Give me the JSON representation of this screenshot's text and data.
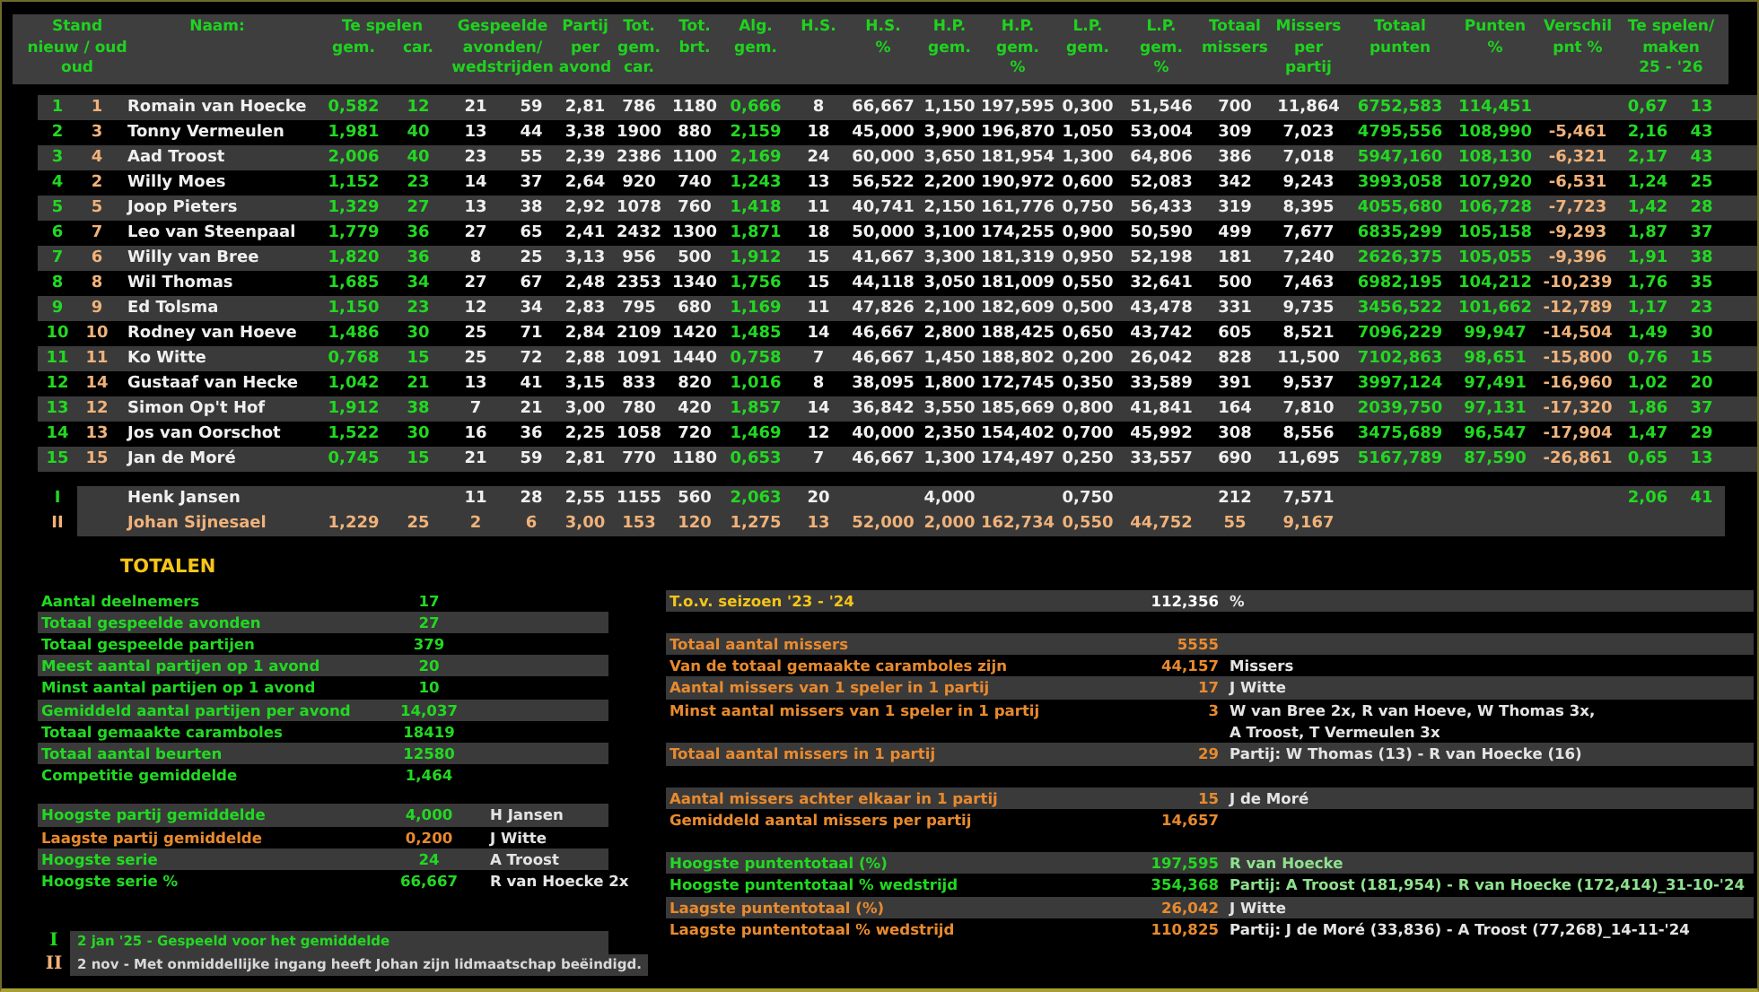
{
  "table": {
    "header": [
      {
        "lines": [
          "Stand",
          "nieuw / oud",
          "oud"
        ],
        "kind": "double"
      },
      {
        "lines": [
          "Naam:"
        ]
      },
      {
        "lines": [
          "Te spelen"
        ],
        "sub": [
          "gem.",
          "car."
        ]
      },
      {
        "lines": [
          "Gespeelde",
          "avonden/",
          "wedstrijden"
        ],
        "kind": "double"
      },
      {
        "lines": [
          "Partij",
          "per",
          "avond"
        ]
      },
      {
        "lines": [
          "Tot.",
          "gem.",
          "car."
        ]
      },
      {
        "lines": [
          "Tot.",
          "brt."
        ]
      },
      {
        "lines": [
          "Alg.",
          "gem."
        ]
      },
      {
        "lines": [
          "H.S."
        ]
      },
      {
        "lines": [
          "H.S.",
          "%"
        ]
      },
      {
        "lines": [
          "H.P.",
          "gem."
        ]
      },
      {
        "lines": [
          "H.P.",
          "gem.",
          "%"
        ]
      },
      {
        "lines": [
          "L.P.",
          "gem."
        ]
      },
      {
        "lines": [
          "L.P.",
          "gem.",
          "%"
        ]
      },
      {
        "lines": [
          "Totaal",
          "missers"
        ]
      },
      {
        "lines": [
          "Missers",
          "per",
          "partij"
        ]
      },
      {
        "lines": [
          "Totaal",
          "punten"
        ]
      },
      {
        "lines": [
          "Punten",
          "%"
        ]
      },
      {
        "lines": [
          "Verschil",
          "pnt %"
        ]
      },
      {
        "lines": [
          "Te spelen/",
          "maken",
          "25 - '26"
        ],
        "kind": "double"
      }
    ],
    "rows": [
      {
        "kind": "regular",
        "cells": [
          "1",
          "1",
          "Romain van Hoecke",
          "0,582",
          "12",
          "21",
          "59",
          "2,81",
          "786",
          "1180",
          "0,666",
          "8",
          "66,667",
          "1,150",
          "197,595",
          "0,300",
          "51,546",
          "700",
          "11,864",
          "6752,583",
          "114,451",
          null,
          "0,67",
          "13"
        ]
      },
      {
        "kind": "regular",
        "cells": [
          "2",
          "3",
          "Tonny Vermeulen",
          "1,981",
          "40",
          "13",
          "44",
          "3,38",
          "1900",
          "880",
          "2,159",
          "18",
          "45,000",
          "3,900",
          "196,870",
          "1,050",
          "53,004",
          "309",
          "7,023",
          "4795,556",
          "108,990",
          "-5,461",
          "2,16",
          "43"
        ]
      },
      {
        "kind": "regular",
        "cells": [
          "3",
          "4",
          "Aad Troost",
          "2,006",
          "40",
          "23",
          "55",
          "2,39",
          "2386",
          "1100",
          "2,169",
          "24",
          "60,000",
          "3,650",
          "181,954",
          "1,300",
          "64,806",
          "386",
          "7,018",
          "5947,160",
          "108,130",
          "-6,321",
          "2,17",
          "43"
        ]
      },
      {
        "kind": "regular",
        "cells": [
          "4",
          "2",
          "Willy Moes",
          "1,152",
          "23",
          "14",
          "37",
          "2,64",
          "920",
          "740",
          "1,243",
          "13",
          "56,522",
          "2,200",
          "190,972",
          "0,600",
          "52,083",
          "342",
          "9,243",
          "3993,058",
          "107,920",
          "-6,531",
          "1,24",
          "25"
        ]
      },
      {
        "kind": "regular",
        "cells": [
          "5",
          "5",
          "Joop Pieters",
          "1,329",
          "27",
          "13",
          "38",
          "2,92",
          "1078",
          "760",
          "1,418",
          "11",
          "40,741",
          "2,150",
          "161,776",
          "0,750",
          "56,433",
          "319",
          "8,395",
          "4055,680",
          "106,728",
          "-7,723",
          "1,42",
          "28"
        ]
      },
      {
        "kind": "regular",
        "cells": [
          "6",
          "7",
          "Leo van Steenpaal",
          "1,779",
          "36",
          "27",
          "65",
          "2,41",
          "2432",
          "1300",
          "1,871",
          "18",
          "50,000",
          "3,100",
          "174,255",
          "0,900",
          "50,590",
          "499",
          "7,677",
          "6835,299",
          "105,158",
          "-9,293",
          "1,87",
          "37"
        ]
      },
      {
        "kind": "regular",
        "cells": [
          "7",
          "6",
          "Willy van Bree",
          "1,820",
          "36",
          "8",
          "25",
          "3,13",
          "956",
          "500",
          "1,912",
          "15",
          "41,667",
          "3,300",
          "181,319",
          "0,950",
          "52,198",
          "181",
          "7,240",
          "2626,375",
          "105,055",
          "-9,396",
          "1,91",
          "38"
        ]
      },
      {
        "kind": "regular",
        "cells": [
          "8",
          "8",
          "Wil Thomas",
          "1,685",
          "34",
          "27",
          "67",
          "2,48",
          "2353",
          "1340",
          "1,756",
          "15",
          "44,118",
          "3,050",
          "181,009",
          "0,550",
          "32,641",
          "500",
          "7,463",
          "6982,195",
          "104,212",
          "-10,239",
          "1,76",
          "35"
        ]
      },
      {
        "kind": "regular",
        "cells": [
          "9",
          "9",
          "Ed Tolsma",
          "1,150",
          "23",
          "12",
          "34",
          "2,83",
          "795",
          "680",
          "1,169",
          "11",
          "47,826",
          "2,100",
          "182,609",
          "0,500",
          "43,478",
          "331",
          "9,735",
          "3456,522",
          "101,662",
          "-12,789",
          "1,17",
          "23"
        ]
      },
      {
        "kind": "regular",
        "cells": [
          "10",
          "10",
          "Rodney van Hoeve",
          "1,486",
          "30",
          "25",
          "71",
          "2,84",
          "2109",
          "1420",
          "1,485",
          "14",
          "46,667",
          "2,800",
          "188,425",
          "0,650",
          "43,742",
          "605",
          "8,521",
          "7096,229",
          "99,947",
          "-14,504",
          "1,49",
          "30"
        ]
      },
      {
        "kind": "regular",
        "cells": [
          "11",
          "11",
          "Ko Witte",
          "0,768",
          "15",
          "25",
          "72",
          "2,88",
          "1091",
          "1440",
          "0,758",
          "7",
          "46,667",
          "1,450",
          "188,802",
          "0,200",
          "26,042",
          "828",
          "11,500",
          "7102,863",
          "98,651",
          "-15,800",
          "0,76",
          "15"
        ]
      },
      {
        "kind": "regular",
        "cells": [
          "12",
          "14",
          "Gustaaf van Hecke",
          "1,042",
          "21",
          "13",
          "41",
          "3,15",
          "833",
          "820",
          "1,016",
          "8",
          "38,095",
          "1,800",
          "172,745",
          "0,350",
          "33,589",
          "391",
          "9,537",
          "3997,124",
          "97,491",
          "-16,960",
          "1,02",
          "20"
        ]
      },
      {
        "kind": "regular",
        "cells": [
          "13",
          "12",
          "Simon Op't Hof",
          "1,912",
          "38",
          "7",
          "21",
          "3,00",
          "780",
          "420",
          "1,857",
          "14",
          "36,842",
          "3,550",
          "185,669",
          "0,800",
          "41,841",
          "164",
          "7,810",
          "2039,750",
          "97,131",
          "-17,320",
          "1,86",
          "37"
        ]
      },
      {
        "kind": "regular",
        "cells": [
          "14",
          "13",
          "Jos van Oorschot",
          "1,522",
          "30",
          "16",
          "36",
          "2,25",
          "1058",
          "720",
          "1,469",
          "12",
          "40,000",
          "2,350",
          "154,402",
          "0,700",
          "45,992",
          "308",
          "8,556",
          "3475,689",
          "96,547",
          "-17,904",
          "1,47",
          "29"
        ]
      },
      {
        "kind": "regular",
        "cells": [
          "15",
          "15",
          "Jan de Moré",
          "0,745",
          "15",
          "21",
          "59",
          "2,81",
          "770",
          "1180",
          "0,653",
          "7",
          "46,667",
          "1,300",
          "174,497",
          "0,250",
          "33,557",
          "690",
          "11,695",
          "5167,789",
          "87,590",
          "-26,861",
          "0,65",
          "13"
        ]
      },
      {
        "kind": "guest",
        "cells": [
          "I",
          null,
          "Henk Jansen",
          null,
          null,
          "11",
          "28",
          "2,55",
          "1155",
          "560",
          "2,063",
          "20",
          null,
          "4,000",
          null,
          "0,750",
          null,
          "212",
          "7,571",
          null,
          null,
          null,
          "2,06",
          "41"
        ]
      },
      {
        "kind": "retired",
        "cells": [
          "II",
          null,
          "Johan Sijnesael",
          "1,229",
          "25",
          "2",
          "6",
          "3,00",
          "153",
          "120",
          "1,275",
          "13",
          "52,000",
          "2,000",
          "162,734",
          "0,550",
          "44,752",
          "55",
          "9,167",
          null,
          null,
          null,
          null,
          null
        ]
      }
    ]
  },
  "totals": {
    "title": "TOTALEN",
    "groups": [
      [
        {
          "kind": "positive",
          "shaded": false,
          "label": "Aantal deelnemers",
          "value": "17"
        },
        {
          "kind": "positive",
          "shaded": true,
          "label": "Totaal gespeelde avonden",
          "value": "27"
        },
        {
          "kind": "positive",
          "shaded": false,
          "label": "Totaal gespeelde partijen",
          "value": "379"
        },
        {
          "kind": "positive",
          "shaded": true,
          "label": "Meest aantal partijen op 1 avond",
          "value": "20"
        },
        {
          "kind": "positive",
          "shaded": false,
          "label": "Minst aantal partijen op 1 avond",
          "value": "10"
        },
        {
          "kind": "positive",
          "shaded": true,
          "label": "Gemiddeld aantal partijen per avond",
          "value": "14,037"
        },
        {
          "kind": "positive",
          "shaded": false,
          "label": "Totaal gemaakte caramboles",
          "value": "18419"
        },
        {
          "kind": "positive",
          "shaded": true,
          "label": "Totaal aantal beurten",
          "value": "12580"
        },
        {
          "kind": "positive",
          "shaded": false,
          "label": "Competitie gemiddelde",
          "value": "1,464"
        }
      ],
      [
        {
          "kind": "positive",
          "shaded": true,
          "label": "Hoogste partij gemiddelde",
          "value": "4,000",
          "note": "H Jansen"
        },
        {
          "kind": "negative",
          "shaded": false,
          "label": "Laagste partij gemiddelde",
          "value": "0,200",
          "note": "J Witte"
        },
        {
          "kind": "positive",
          "shaded": true,
          "label": "Hoogste serie",
          "value": "24",
          "note": "A Troost"
        },
        {
          "kind": "positive",
          "shaded": false,
          "label": "Hoogste serie %",
          "value": "66,667",
          "note": "R van Hoecke 2x"
        }
      ]
    ]
  },
  "footnotes": [
    {
      "kind": "guest",
      "marker": "I",
      "text": "2 jan '25 - Gespeeld voor het gemiddelde"
    },
    {
      "kind": "retired",
      "marker": "II",
      "text": "2 nov - Met onmiddellijke ingang heeft Johan zijn lidmaatschap beëindigd."
    }
  ],
  "records": {
    "groups": [
      [
        {
          "kind": "reference",
          "shaded": true,
          "label": "T.o.v. seizoen '23 - '24",
          "value": "112,356",
          "note_lines": [
            "%"
          ]
        }
      ],
      [
        {
          "kind": "negative",
          "shaded": true,
          "label": "Totaal aantal missers",
          "value": "5555"
        },
        {
          "kind": "negative",
          "shaded": false,
          "label": "Van de totaal gemaakte caramboles zijn",
          "value": "44,157",
          "note_lines": [
            "Missers"
          ]
        },
        {
          "kind": "negative",
          "shaded": true,
          "label": "Aantal missers van 1 speler in 1 partij",
          "value": "17",
          "note_lines": [
            "J Witte"
          ]
        },
        {
          "kind": "negative",
          "shaded": false,
          "label": "Minst aantal missers van 1 speler in 1 partij",
          "value": "3",
          "note_lines": [
            "W van Bree 2x, R van Hoeve, W Thomas 3x,",
            "A Troost, T Vermeulen 3x"
          ]
        },
        {
          "kind": "negative",
          "shaded": true,
          "label": "Totaal aantal missers in 1 partij",
          "value": "29",
          "note_lines": [
            "Partij: W Thomas (13) - R van Hoecke (16)"
          ]
        }
      ],
      [
        {
          "kind": "negative",
          "shaded": true,
          "label": "Aantal missers achter elkaar in 1 partij",
          "value": "15",
          "note_lines": [
            "J de Moré"
          ]
        },
        {
          "kind": "negative",
          "shaded": false,
          "label": "Gemiddeld aantal missers per partij",
          "value": "14,657"
        }
      ],
      [
        {
          "kind": "positive",
          "shaded": true,
          "label": "Hoogste puntentotaal (%)",
          "value": "197,595",
          "note_lines": [
            "R van Hoecke"
          ]
        },
        {
          "kind": "positive",
          "shaded": false,
          "label": "Hoogste puntentotaal % wedstrijd",
          "value": "354,368",
          "note_lines": [
            "Partij: A Troost (181,954) - R van Hoecke (172,414)_31-10-'24"
          ]
        },
        {
          "kind": "negative",
          "shaded": true,
          "label": "Laagste puntentotaal (%)",
          "value": "26,042",
          "note_lines": [
            "J Witte"
          ]
        },
        {
          "kind": "negative",
          "shaded": false,
          "label": "Laagste puntentotaal % wedstrijd",
          "value": "110,825",
          "note_lines": [
            "Partij: J de Moré (33,836) - A Troost (77,268)_14-11-'24"
          ]
        }
      ]
    ]
  }
}
